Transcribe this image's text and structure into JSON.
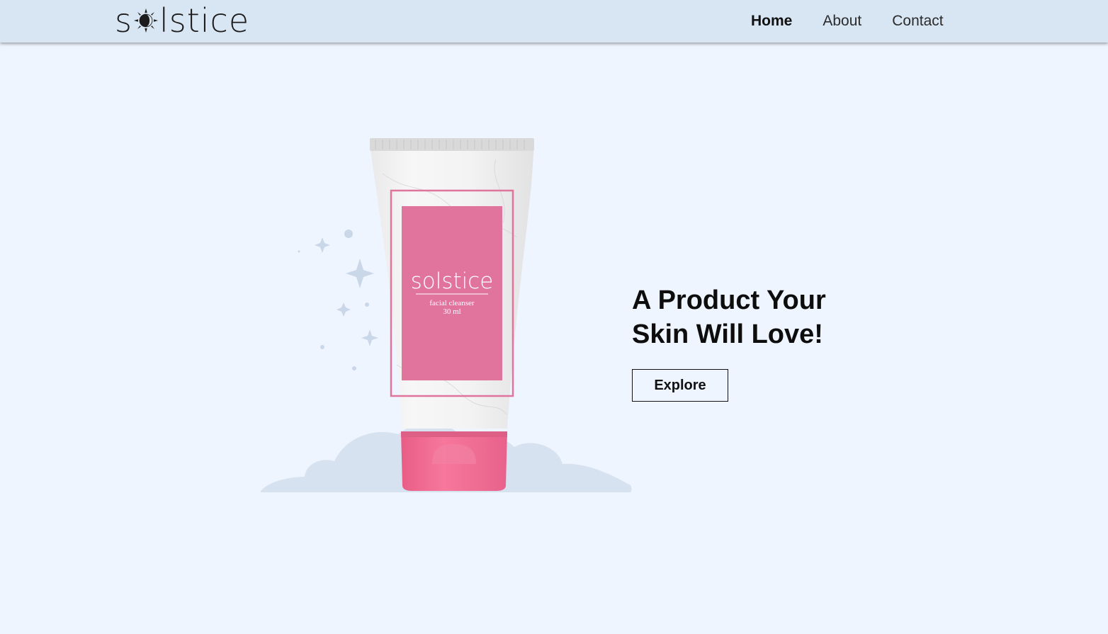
{
  "brand": {
    "logo_prefix": "s",
    "logo_suffix": "lstice",
    "label_brand": "solstice",
    "label_product": "facial cleanser",
    "label_size": "30 ml"
  },
  "nav": {
    "items": [
      {
        "label": "Home",
        "active": true
      },
      {
        "label": "About",
        "active": false
      },
      {
        "label": "Contact",
        "active": false
      }
    ]
  },
  "hero": {
    "headline_line1": "A Product Your",
    "headline_line2": "Skin Will Love!",
    "button_label": "Explore"
  },
  "colors": {
    "page_bg": "#eff5ff",
    "navbar_bg": "#d8e5f3",
    "tube_pink": "#e0749c",
    "cap_pink": "#f46d94",
    "cloud": "#d5e2f0"
  }
}
